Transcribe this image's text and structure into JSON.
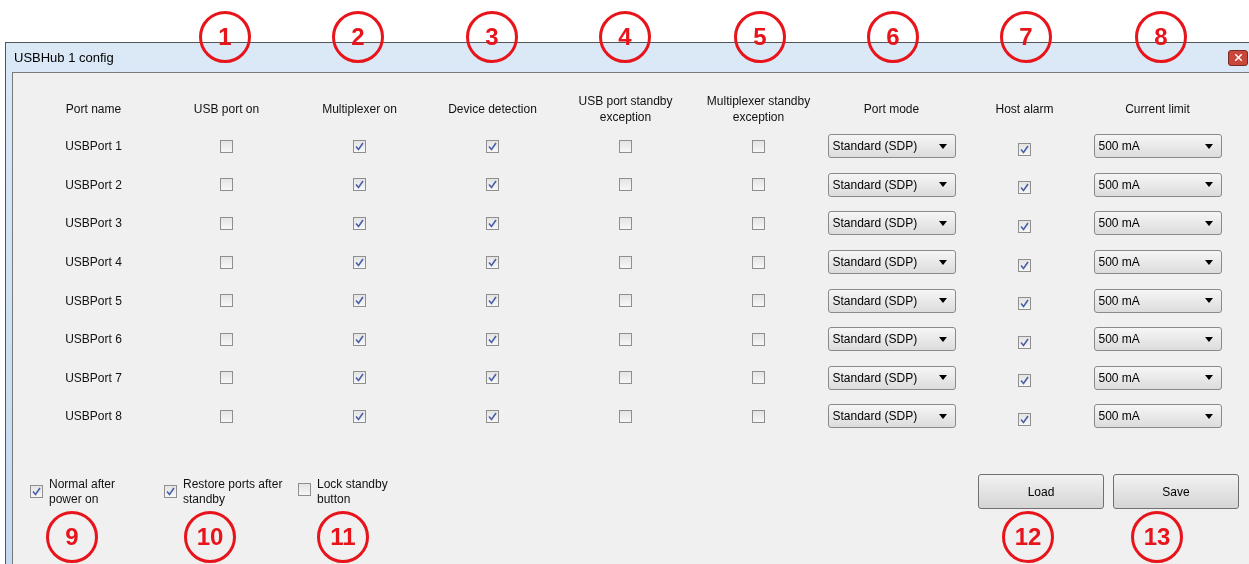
{
  "window": {
    "title": "USBHub 1 config"
  },
  "columns": [
    "Port name",
    "USB port on",
    "Multiplexer on",
    "Device detection",
    "USB port standby exception",
    "Multiplexer standby exception",
    "Port mode",
    "Host alarm",
    "Current limit"
  ],
  "rows": [
    {
      "name": "USBPort 1",
      "usb_port_on": false,
      "multiplexer_on": true,
      "device_detection": true,
      "usb_standby_exception": false,
      "multiplexer_standby_exception": false,
      "port_mode": "Standard (SDP)",
      "host_alarm": true,
      "current_limit": "500 mA"
    },
    {
      "name": "USBPort 2",
      "usb_port_on": false,
      "multiplexer_on": true,
      "device_detection": true,
      "usb_standby_exception": false,
      "multiplexer_standby_exception": false,
      "port_mode": "Standard (SDP)",
      "host_alarm": true,
      "current_limit": "500 mA"
    },
    {
      "name": "USBPort 3",
      "usb_port_on": false,
      "multiplexer_on": true,
      "device_detection": true,
      "usb_standby_exception": false,
      "multiplexer_standby_exception": false,
      "port_mode": "Standard (SDP)",
      "host_alarm": true,
      "current_limit": "500 mA"
    },
    {
      "name": "USBPort 4",
      "usb_port_on": false,
      "multiplexer_on": true,
      "device_detection": true,
      "usb_standby_exception": false,
      "multiplexer_standby_exception": false,
      "port_mode": "Standard (SDP)",
      "host_alarm": true,
      "current_limit": "500 mA"
    },
    {
      "name": "USBPort 5",
      "usb_port_on": false,
      "multiplexer_on": true,
      "device_detection": true,
      "usb_standby_exception": false,
      "multiplexer_standby_exception": false,
      "port_mode": "Standard (SDP)",
      "host_alarm": true,
      "current_limit": "500 mA"
    },
    {
      "name": "USBPort 6",
      "usb_port_on": false,
      "multiplexer_on": true,
      "device_detection": true,
      "usb_standby_exception": false,
      "multiplexer_standby_exception": false,
      "port_mode": "Standard (SDP)",
      "host_alarm": true,
      "current_limit": "500 mA"
    },
    {
      "name": "USBPort 7",
      "usb_port_on": false,
      "multiplexer_on": true,
      "device_detection": true,
      "usb_standby_exception": false,
      "multiplexer_standby_exception": false,
      "port_mode": "Standard (SDP)",
      "host_alarm": true,
      "current_limit": "500 mA"
    },
    {
      "name": "USBPort 8",
      "usb_port_on": false,
      "multiplexer_on": true,
      "device_detection": true,
      "usb_standby_exception": false,
      "multiplexer_standby_exception": false,
      "port_mode": "Standard (SDP)",
      "host_alarm": true,
      "current_limit": "500 mA"
    }
  ],
  "options": [
    {
      "label": "Normal after power on",
      "checked": true
    },
    {
      "label": "Restore ports after standby",
      "checked": true
    },
    {
      "label": "Lock standby button",
      "checked": false
    }
  ],
  "buttons": [
    "Load",
    "Save"
  ],
  "callouts": [
    "1",
    "2",
    "3",
    "4",
    "5",
    "6",
    "7",
    "8",
    "9",
    "10",
    "11",
    "12",
    "13"
  ]
}
